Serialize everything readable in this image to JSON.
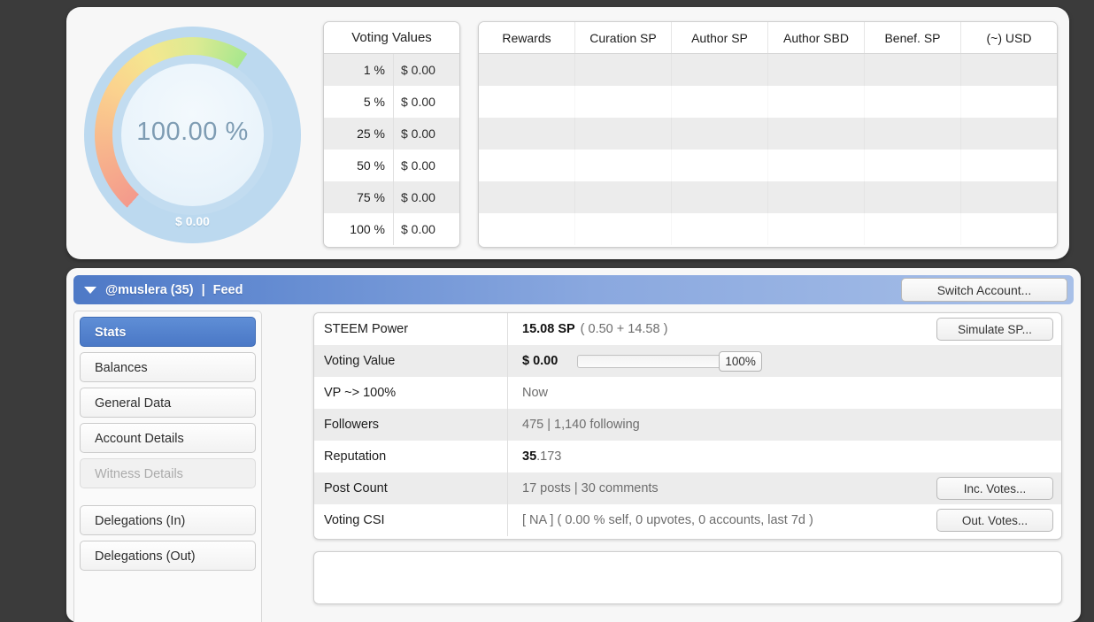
{
  "gauge": {
    "percent": "100.00 %",
    "usd": "$ 0.00",
    "accent_track": "#bcd9ef",
    "accent_text": "#7e9cb3"
  },
  "voting_values": {
    "title": "Voting Values",
    "rows": [
      {
        "pct": "1 %",
        "value": "$ 0.00"
      },
      {
        "pct": "5 %",
        "value": "$ 0.00"
      },
      {
        "pct": "25 %",
        "value": "$ 0.00"
      },
      {
        "pct": "50 %",
        "value": "$ 0.00"
      },
      {
        "pct": "75 %",
        "value": "$ 0.00"
      },
      {
        "pct": "100 %",
        "value": "$ 0.00"
      }
    ]
  },
  "rewards_table": {
    "headers": [
      "Rewards",
      "Curation SP",
      "Author SP",
      "Author SBD",
      "Benef. SP",
      "(~) USD"
    ],
    "rows": [
      [
        "",
        "",
        "",
        "",
        "",
        ""
      ],
      [
        "",
        "",
        "",
        "",
        "",
        ""
      ],
      [
        "",
        "",
        "",
        "",
        "",
        ""
      ],
      [
        "",
        "",
        "",
        "",
        "",
        ""
      ],
      [
        "",
        "",
        "",
        "",
        "",
        ""
      ],
      [
        "",
        "",
        "",
        "",
        "",
        ""
      ]
    ]
  },
  "account_bar": {
    "caret_icon": "caret-down-icon",
    "account": "@muslera (35)",
    "separator": "|",
    "feed": "Feed",
    "switch_account_label": "Switch Account...",
    "accent": "#4e79c6"
  },
  "sidebar": {
    "items": [
      {
        "label": "Stats",
        "state": "active"
      },
      {
        "label": "Balances",
        "state": "normal"
      },
      {
        "label": "General Data",
        "state": "normal"
      },
      {
        "label": "Account Details",
        "state": "normal"
      },
      {
        "label": "Witness Details",
        "state": "disabled"
      },
      {
        "label": "Delegations (In)",
        "state": "normal"
      },
      {
        "label": "Delegations (Out)",
        "state": "normal"
      }
    ]
  },
  "stats": {
    "rows": [
      {
        "label": "STEEM Power",
        "value_strong": "15.08 SP",
        "value_dim": "( 0.50 + 14.58 )",
        "button": "Simulate SP..."
      },
      {
        "label": "Voting Value",
        "value_strong": "$ 0.00",
        "value_dim": "",
        "slider_value": "100%",
        "button": ""
      },
      {
        "label": "VP ~> 100%",
        "value_strong": "",
        "value_dim": "Now",
        "button": ""
      },
      {
        "label": "Followers",
        "value_strong": "",
        "value_dim": "475 | 1,140 following",
        "button": ""
      },
      {
        "label": "Reputation",
        "value_strong": "35",
        "value_dim": ".173",
        "button": ""
      },
      {
        "label": "Post Count",
        "value_strong": "",
        "value_dim": "17 posts | 30 comments",
        "button": "Inc. Votes..."
      },
      {
        "label": "Voting CSI",
        "value_strong": "",
        "value_dim": "[ NA ] ( 0.00 % self, 0 upvotes, 0 accounts, last 7d )",
        "button": "Out. Votes..."
      }
    ]
  }
}
